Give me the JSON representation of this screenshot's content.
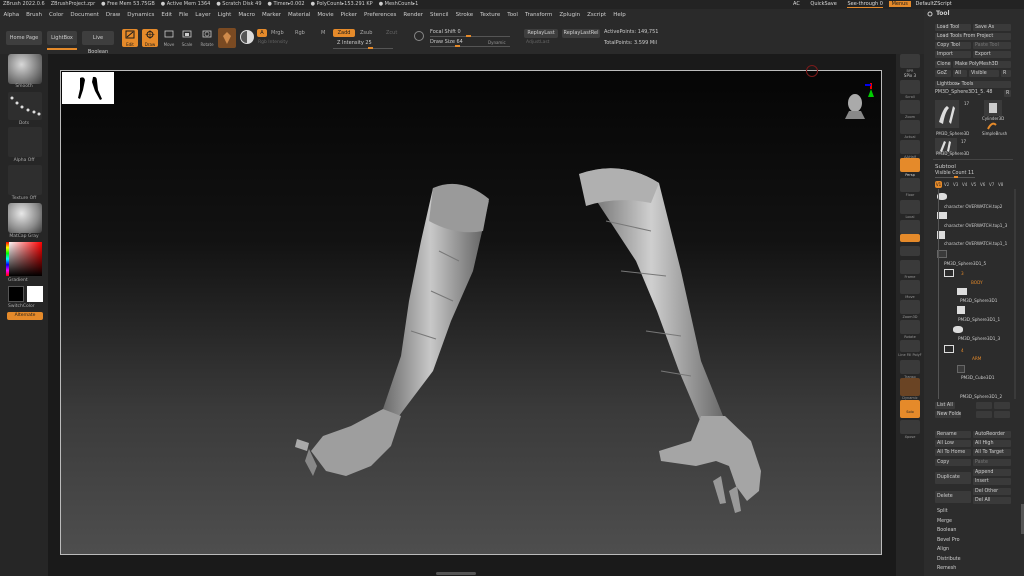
{
  "titlebar": {
    "items": [
      "ZBrush 2022.0.6",
      "ZBrushProject.zpr",
      "● Free Mem 53.75GB",
      "● Active Mem 1364",
      "● Scratch Disk 49",
      "● Timer▸0.002",
      "● PolyCount▸153.291 KP",
      "● MeshCount▸1"
    ],
    "ac": "AC",
    "quicksave": "QuickSave",
    "seethrough": "See-through 0",
    "menus": "Menus",
    "defaultscript": "DefaultZScript"
  },
  "menubar": [
    "Alpha",
    "Brush",
    "Color",
    "Document",
    "Draw",
    "Dynamics",
    "Edit",
    "File",
    "Layer",
    "Light",
    "Macro",
    "Marker",
    "Material",
    "Movie",
    "Picker",
    "Preferences",
    "Render",
    "Stencil",
    "Stroke",
    "Texture",
    "Tool",
    "Transform",
    "Zplugin",
    "Zscript",
    "Help"
  ],
  "shelf": {
    "home_page": "Home Page",
    "lightbox": "LightBox",
    "live_boolean": "Live Boolean",
    "edit": "Edit",
    "draw": "Draw",
    "move": "Move",
    "scale": "Scale",
    "rotate": "Rotate",
    "a": "A",
    "mrgb": "Mrgb",
    "rgb": "Rgb",
    "m": "M",
    "zadd": "Zadd",
    "zsub": "Zsub",
    "zcut": "Zcut",
    "rgb_intensity": "Rgb Intensity",
    "z_intensity": "Z Intensity 25",
    "focal_shift": "Focal Shift 0",
    "draw_size": "Draw Size 64",
    "dynamic": "Dynamic",
    "replaylast": "ReplayLast",
    "replaylastrel": "ReplayLastRel",
    "adjustlast": "AdjustLast",
    "active_points": "ActivePoints: 149,751",
    "total_points": "TotalPoints: 3.599 Mil"
  },
  "left_tray": {
    "brush": "Smooth",
    "stroke": "Dots",
    "alpha": "Alpha Off",
    "texture": "Texture Off",
    "material": "MatCap Gray",
    "gradient": "Gradient",
    "switchcolor": "SwitchColor",
    "alternate": "Alternate"
  },
  "right_shelf": [
    "BPR",
    "SPix 3",
    "Scroll",
    "Zoom",
    "Actual",
    "AAHalf",
    "Persp",
    "Floor",
    "Local",
    "Frame",
    "Move",
    "Zoom3D",
    "Rotate",
    "Line Fill PolyF",
    "Transp",
    "Dynamic",
    "Solo",
    "Xpose"
  ],
  "tool_panel": {
    "title": "Tool",
    "load_tool": "Load Tool",
    "save_as": "Save As",
    "load_from_project": "Load Tools From Project",
    "copy_tool": "Copy Tool",
    "paste_tool": "Paste Tool",
    "import": "Import",
    "export": "Export",
    "clone": "Clone",
    "make_polymesh": "Make PolyMesh3D",
    "goz": "GoZ",
    "all": "All",
    "visible": "Visible",
    "r": "R",
    "lightbox_tools": "Lightbox▸ Tools",
    "current_tool": "PM3D_Sphere3D1_5. 48",
    "tool_thumbs": [
      "PM3D_Sphere3D",
      "Cylinder3D",
      "SimpleBrush",
      "PM3D_Sphere3D"
    ],
    "thumb_count": "17",
    "subtool": "Subtool",
    "visible_count": "Visible Count 11",
    "v_buttons": [
      "V1",
      "V2",
      "V3",
      "V4",
      "V5",
      "V6",
      "V7",
      "V8"
    ],
    "subtools": [
      "character OVERWATCH.top2",
      "character OVERWATCH.top1_3",
      "character OVERWATCH.top1_1",
      "PM3D_Sphere3D1_5",
      "BODY",
      "PM3D_Sphere3D1",
      "PM3D_Sphere3D1_1",
      "PM3D_Sphere3D1_3",
      "ARM",
      "PM3D_Cube3D1",
      "PM3D_Sphere3D1_2"
    ],
    "folder_counts": [
      "3",
      "4"
    ],
    "list_all": "List All",
    "new_folder": "New Folder",
    "rename": "Rename",
    "autoreorder": "AutoReorder",
    "all_low": "All Low",
    "all_high": "All High",
    "all_to_home": "All To Home",
    "all_to_target": "All To Target",
    "copy": "Copy",
    "paste": "Paste",
    "duplicate": "Duplicate",
    "append": "Append",
    "insert": "Insert",
    "delete": "Delete",
    "del_other": "Del Other",
    "del_all": "Del All",
    "split": "Split",
    "merge": "Merge",
    "boolean": "Boolean",
    "bevel_pro": "Bevel Pro",
    "align": "Align",
    "distribute": "Distribute",
    "remesh": "Remesh"
  },
  "colors": {
    "accent": "#e58a2a",
    "panel": "#2c2c2c",
    "button": "#3e3e3e"
  }
}
